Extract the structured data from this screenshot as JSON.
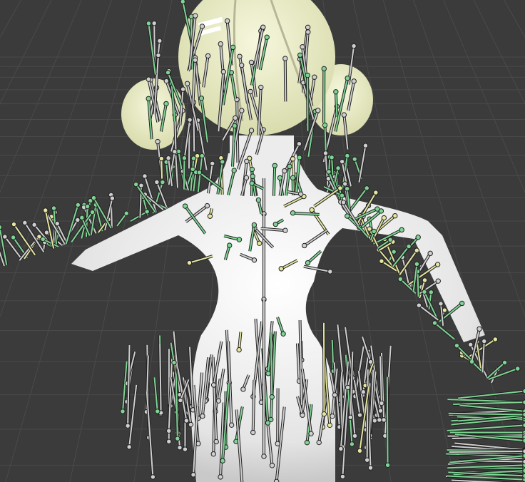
{
  "viewport": {
    "kind": "3d-viewport",
    "background_color": "#3b3b3b",
    "grid_color": "#4a4a4a",
    "model_color": "#f2f2f2",
    "hair_color": "#eef0c8",
    "bone_colors": {
      "physics": "#7fd494",
      "deform": "#e6e6a0",
      "other": "#cfcfcf",
      "outline": "#222222"
    }
  }
}
